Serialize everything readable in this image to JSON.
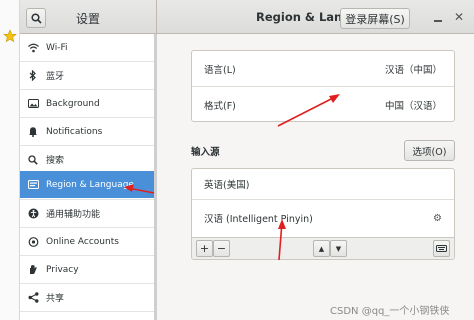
{
  "window": {
    "sidebar_title": "设置",
    "panel_title": "Region & Language",
    "login_screen_button": "登录屏幕(S)"
  },
  "sidebar": {
    "items": [
      {
        "label": "Wi-Fi",
        "icon": "wifi-icon"
      },
      {
        "label": "蓝牙",
        "icon": "bluetooth-icon"
      },
      {
        "label": "Background",
        "icon": "background-icon"
      },
      {
        "label": "Notifications",
        "icon": "bell-icon"
      },
      {
        "label": "搜索",
        "icon": "search-icon"
      },
      {
        "label": "Region & Language",
        "icon": "region-flag-icon",
        "selected": true
      },
      {
        "label": "通用辅助功能",
        "icon": "accessibility-icon"
      },
      {
        "label": "Online Accounts",
        "icon": "online-accounts-icon"
      },
      {
        "label": "Privacy",
        "icon": "privacy-hand-icon"
      },
      {
        "label": "共享",
        "icon": "share-icon"
      }
    ]
  },
  "language_section": {
    "language_label": "语言(L)",
    "language_value": "汉语（中国）",
    "formats_label": "格式(F)",
    "formats_value": "中国（汉语）"
  },
  "input_sources": {
    "heading": "输入源",
    "options_button": "选项(O)",
    "sources": [
      "英语(美国)",
      "汉语 (Intelligent Pinyin)"
    ],
    "toolbar": {
      "add": "+",
      "remove": "−",
      "up": "▲",
      "down": "▼"
    }
  },
  "watermark": "CSDN @qq_一个小钢铁侠",
  "colors": {
    "selected": "#4a90d9",
    "annotation": "#e02020"
  }
}
